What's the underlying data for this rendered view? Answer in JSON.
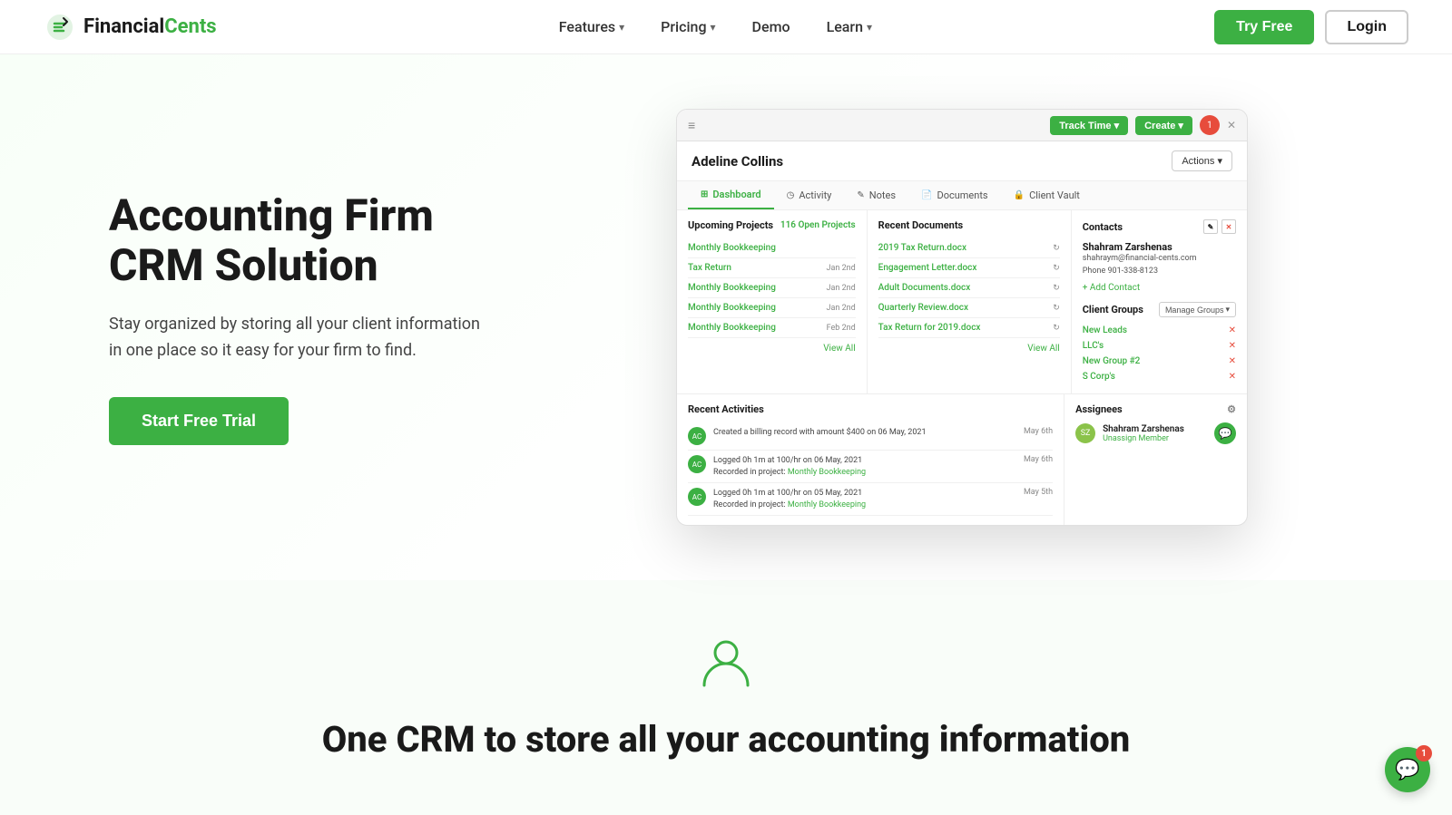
{
  "navbar": {
    "logo_text_dark": "Financial",
    "logo_text_green": "Cents",
    "nav_items": [
      {
        "label": "Features",
        "has_dropdown": true
      },
      {
        "label": "Pricing",
        "has_dropdown": true
      },
      {
        "label": "Demo",
        "has_dropdown": false
      },
      {
        "label": "Learn",
        "has_dropdown": true
      }
    ],
    "try_free_label": "Try Free",
    "login_label": "Login"
  },
  "hero": {
    "title": "Accounting Firm CRM Solution",
    "description": "Stay organized by storing all your client information in one place so it easy for your firm to find.",
    "cta_label": "Start Free Trial"
  },
  "app_screenshot": {
    "track_time_label": "Track Time",
    "create_label": "Create",
    "client_name": "Adeline Collins",
    "actions_label": "Actions",
    "tabs": [
      {
        "label": "Dashboard",
        "icon": "⊞",
        "active": true
      },
      {
        "label": "Activity",
        "icon": "◷"
      },
      {
        "label": "Notes",
        "icon": "✎"
      },
      {
        "label": "Documents",
        "icon": "📄"
      },
      {
        "label": "Client Vault",
        "icon": "🔒"
      }
    ],
    "upcoming_projects": {
      "title": "Upcoming Projects",
      "badge": "116 Open Projects",
      "items": [
        {
          "name": "Monthly Bookkeeping",
          "date": ""
        },
        {
          "name": "Tax Return",
          "date": "Jan 2nd"
        },
        {
          "name": "Monthly Bookkeeping",
          "date": "Jan 2nd"
        },
        {
          "name": "Monthly Bookkeeping",
          "date": "Jan 2nd"
        },
        {
          "name": "Monthly Bookkeeping",
          "date": "Feb 2nd"
        }
      ],
      "view_all": "View All"
    },
    "recent_documents": {
      "title": "Recent Documents",
      "items": [
        {
          "name": "2019 Tax Return.docx"
        },
        {
          "name": "Engagement Letter.docx"
        },
        {
          "name": "Adult Documents.docx"
        },
        {
          "name": "Quarterly Review.docx"
        },
        {
          "name": "Tax Return for 2019.docx"
        }
      ],
      "view_all": "View All"
    },
    "contacts": {
      "title": "Contacts",
      "contact_name": "Shahram Zarshenas",
      "email": "shahraym@financial-cents.com",
      "phone": "Phone 901-338-8123",
      "add_contact": "+ Add Contact"
    },
    "client_groups": {
      "title": "Client Groups",
      "manage_label": "Manage Groups",
      "groups": [
        {
          "name": "New Leads"
        },
        {
          "name": "LLC's"
        },
        {
          "name": "New Group #2"
        },
        {
          "name": "S Corp's"
        }
      ]
    },
    "activities": {
      "title": "Recent Activities",
      "items": [
        {
          "text": "Created a billing record with amount $400 on 06 May, 2021",
          "date": "May 6th",
          "initials": "AC"
        },
        {
          "text": "Logged 0h 1m at 100/hr on 06 May, 2021 Recorded in project: Monthly Bookkeeping",
          "date": "May 6th",
          "initials": "AC",
          "link": "Monthly Bookkeeping"
        },
        {
          "text": "Logged 0h 1m at 100/hr on 05 May, 2021 Recorded in project: Monthly Bookkeeping",
          "date": "May 5th",
          "initials": "AC",
          "link": "Monthly Bookkeeping"
        }
      ]
    },
    "assignees": {
      "title": "Assignees",
      "assignee_name": "Shahram Zarshenas",
      "unassign_label": "Unassign Member",
      "initials": "SZ"
    }
  },
  "section2": {
    "title": "One CRM to store all your accounting information",
    "icon": "person"
  },
  "chat": {
    "badge": "1"
  }
}
